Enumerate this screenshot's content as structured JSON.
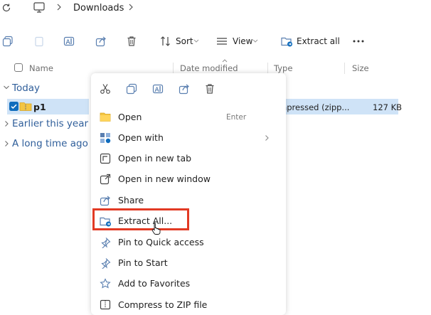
{
  "address": {
    "path": [
      "Downloads"
    ]
  },
  "toolbar": {
    "sort_label": "Sort",
    "view_label": "View",
    "extract_label": "Extract all"
  },
  "columns": {
    "name": "Name",
    "date": "Date modified",
    "type": "Type",
    "size": "Size"
  },
  "groups": [
    "Today",
    "Earlier this year",
    "A long time ago"
  ],
  "file": {
    "name": "p1",
    "type": "ompressed (zipp...",
    "size": "127 KB"
  },
  "menu": {
    "items": [
      {
        "label": "Open",
        "accel": "Enter"
      },
      {
        "label": "Open with"
      },
      {
        "label": "Open in new tab"
      },
      {
        "label": "Open in new window"
      },
      {
        "label": "Share"
      },
      {
        "label": "Extract All..."
      },
      {
        "label": "Pin to Quick access"
      },
      {
        "label": "Pin to Start"
      },
      {
        "label": "Add to Favorites"
      },
      {
        "label": "Compress to ZIP file"
      }
    ]
  },
  "colors": {
    "accent": "#0f6cbd",
    "highlight": "#e23a24",
    "group_text": "#2f5e9a"
  }
}
